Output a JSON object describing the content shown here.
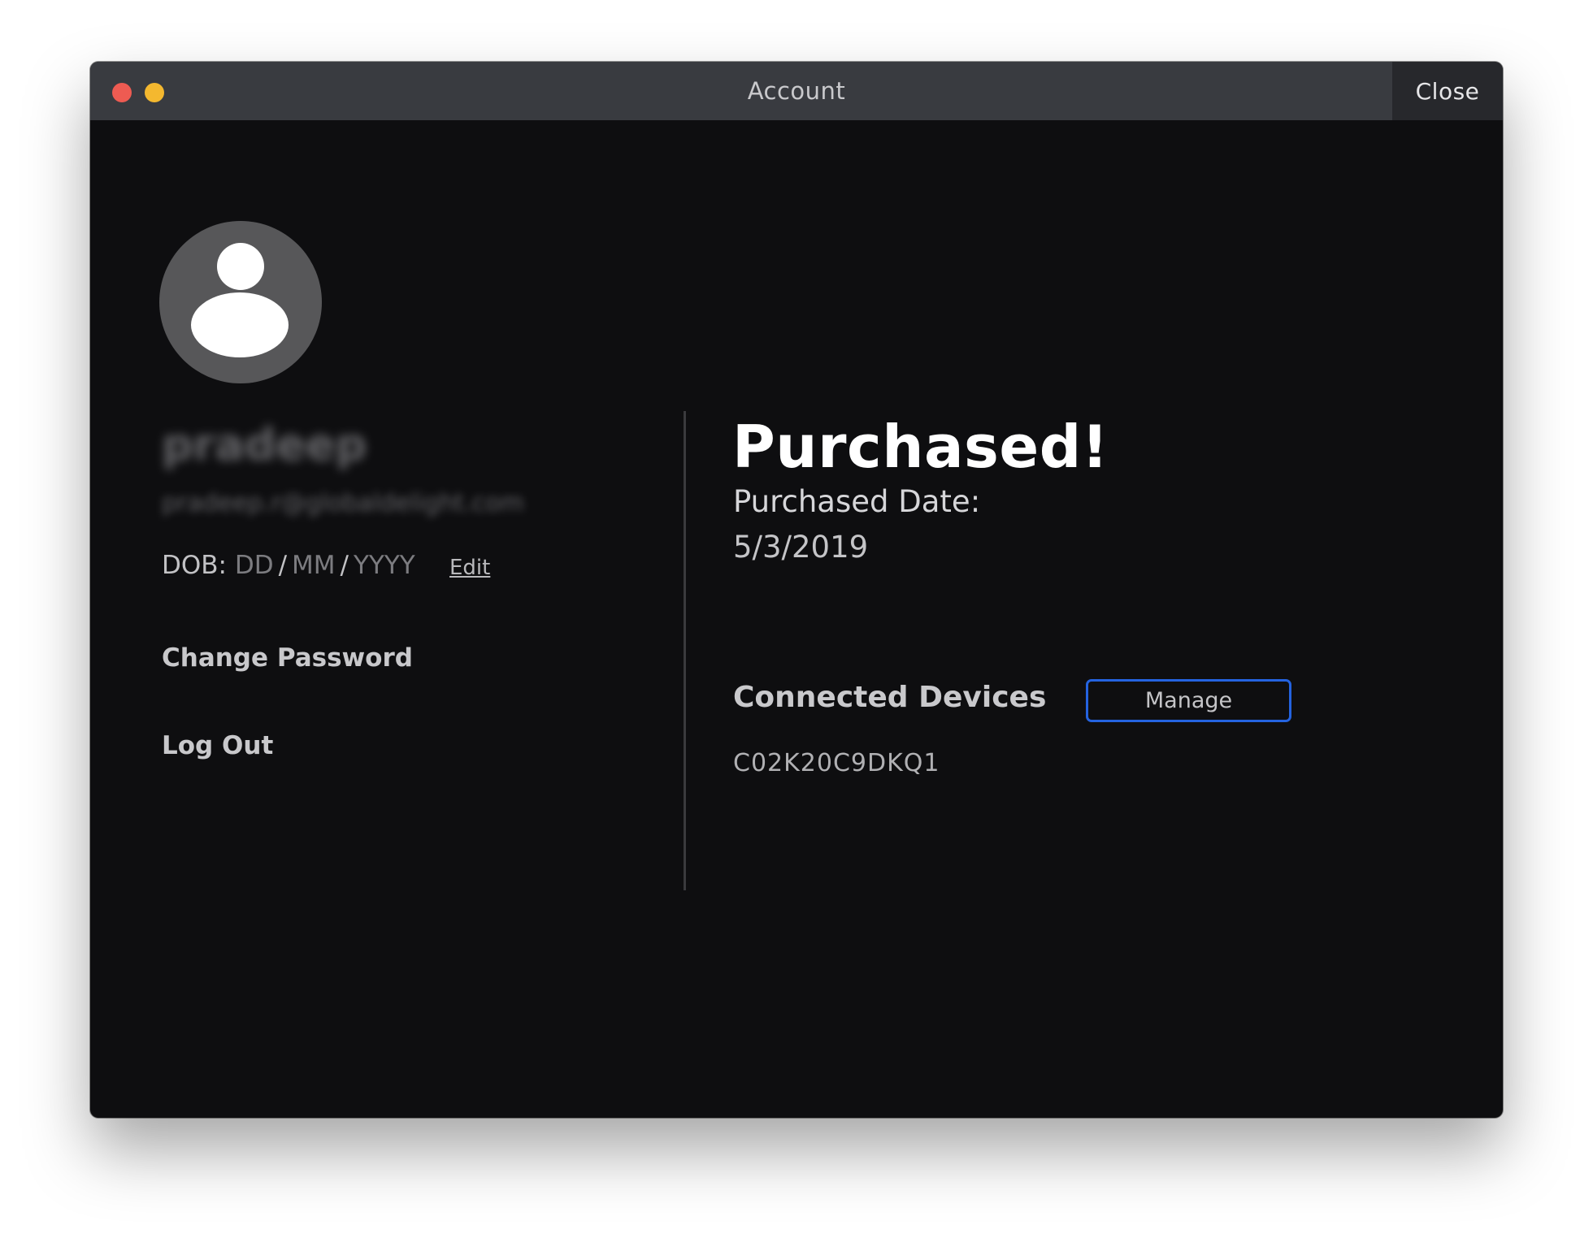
{
  "window": {
    "title": "Account",
    "close_label": "Close"
  },
  "profile": {
    "avatar_icon": "user-avatar-icon",
    "username": "pradeep",
    "email": "pradeep.r@globaldelight.com",
    "dob": {
      "label": "DOB:",
      "day": "DD",
      "month": "MM",
      "year": "YYYY",
      "separator": "/",
      "edit_label": "Edit"
    },
    "change_password_label": "Change Password",
    "logout_label": "Log Out"
  },
  "purchase": {
    "heading": "Purchased!",
    "date_label": "Purchased Date:",
    "date_value": "5/3/2019"
  },
  "devices": {
    "heading": "Connected Devices",
    "manage_label": "Manage",
    "items": [
      "C02K20C9DKQ1"
    ]
  },
  "colors": {
    "background": "#0e0e10",
    "titlebar": "#393b40",
    "accent_border": "#2463e0",
    "traffic_red": "#ee5b52",
    "traffic_yellow": "#f4b82f"
  }
}
